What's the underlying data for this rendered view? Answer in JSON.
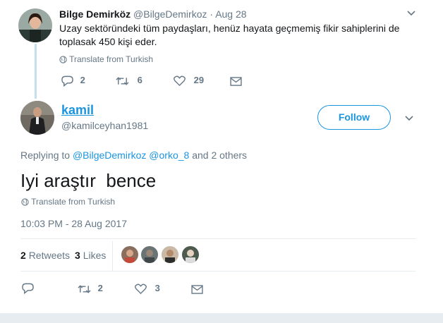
{
  "parent_tweet": {
    "author_name": "Bilge Demirköz",
    "author_handle": "@BilgeDemirkoz",
    "separator": "·",
    "date": "Aug 28",
    "text_line1": "Uzay sektöründeki tüm paydaşları, henüz hayata geçmemiş fikir sahiplerini de",
    "text_line2": "toplasak 450 kişi eder.",
    "translate_label": "Translate from Turkish",
    "replies": "2",
    "retweets": "6",
    "likes": "29"
  },
  "main_tweet": {
    "author_name": "kamil",
    "author_handle": "@kamilceyhan1981",
    "follow_label": "Follow",
    "replying_prefix": "Replying to",
    "replying_user1": "@BilgeDemirkoz",
    "replying_user2": "@orko_8",
    "replying_suffix": "and 2 others",
    "text": "Iyi araştır  bence",
    "translate_label": "Translate from Turkish",
    "timestamp": "10:03 PM - 28 Aug 2017",
    "retweet_count": "2",
    "retweet_label": "Retweets",
    "like_count": "3",
    "like_label": "Likes",
    "action_retweets": "2",
    "action_likes": "3"
  },
  "colors": {
    "accent": "#1b95e0",
    "muted": "#657786",
    "thread_line": "#c3e0ef",
    "divider": "#e6ecf0"
  }
}
